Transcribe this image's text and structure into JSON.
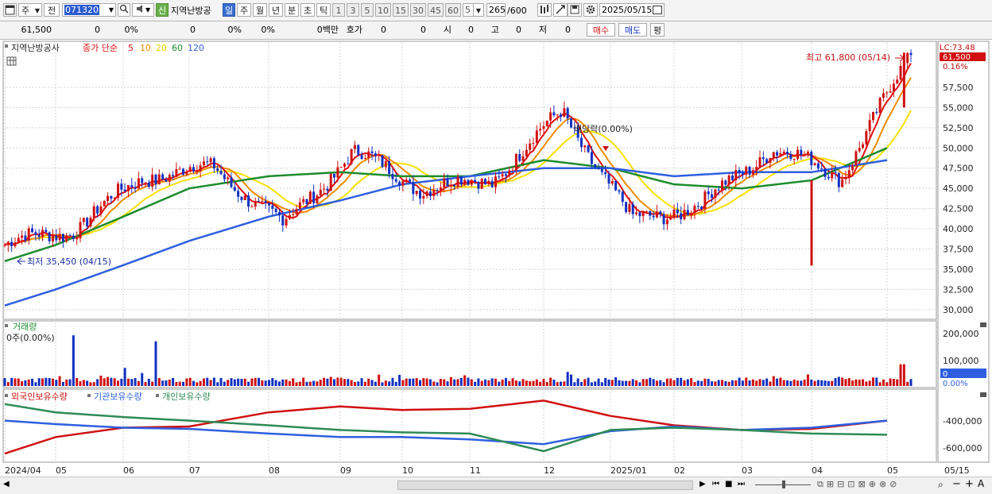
{
  "toolbar": {
    "market_btn": "주",
    "prev_btn": "전",
    "code": "071320",
    "stock_name": "지역난방공",
    "credit_badge": "신",
    "periods": [
      "일",
      "주",
      "월",
      "년",
      "분",
      "초",
      "틱"
    ],
    "selected_period": "일",
    "intervals": [
      "1",
      "3",
      "5",
      "10",
      "15",
      "30",
      "45",
      "60"
    ],
    "interval_value": "5",
    "count": "265",
    "count_max": "/600",
    "date": "2025/05/15"
  },
  "quote": {
    "price": "61,500",
    "change": "0",
    "change_pct": "0%",
    "volume": "0",
    "vol_pct": "0%",
    "vol_pct2": "0%",
    "amount": "0백만",
    "hoga_label": "호가",
    "hoga1": "0",
    "hoga2": "0",
    "open_label": "시",
    "open": "0",
    "high_label": "고",
    "high": "0",
    "low_label": "저",
    "low": "0",
    "buy_btn": "매수",
    "sell_btn": "매도",
    "eval_btn": "평"
  },
  "legend": {
    "stock": "지역난방공사",
    "ma_title": "종가 단순",
    "ma_periods": [
      "5",
      "10",
      "20",
      "60",
      "120"
    ],
    "ma_colors": [
      "#e01010",
      "#f08c00",
      "#f5e100",
      "#1e8c2d",
      "#2f5fe0"
    ]
  },
  "annotations": {
    "high": "최고 61,800 (05/14)",
    "low": "최저 35,450 (04/15)",
    "dividend": "배당락(0.00%)"
  },
  "right_axis": {
    "lc": "LC:73.48",
    "price_tag": "61,500",
    "pct_tag": "0.16%",
    "price_ticks": [
      "57,500",
      "55,000",
      "52,500",
      "50,000",
      "47,500",
      "45,000",
      "42,500",
      "40,000",
      "37,500",
      "35,000",
      "32,500",
      "30,000"
    ],
    "vol_ticks": [
      "200,000",
      "100,000"
    ],
    "vol_tag": "0",
    "vol_pct": "0.00%",
    "hold_ticks": [
      "-400,000",
      "-600,000"
    ]
  },
  "volume_panel": {
    "title": "거래량",
    "value": "0주(0.00%)"
  },
  "holdings_panel": {
    "series": [
      "외국인보유수량",
      "기관보유수량",
      "개인보유수량"
    ]
  },
  "x_axis": {
    "labels": [
      "2024/04",
      "05",
      "06",
      "07",
      "08",
      "09",
      "10",
      "11",
      "12",
      "2025/01",
      "02",
      "03",
      "04",
      "05"
    ],
    "end_label": "05/15"
  },
  "chart_data": {
    "type": "candlestick",
    "title": "지역난방공사",
    "x_range": [
      "2024/04",
      "2025/05/15"
    ],
    "y_range": [
      29000,
      63000
    ],
    "price_points": [
      {
        "month": "2024/04",
        "close": 38000
      },
      {
        "month": "05",
        "close": 40000
      },
      {
        "month": "06",
        "close": 46500
      },
      {
        "month": "07",
        "close": 47500
      },
      {
        "month": "08",
        "close": 40500
      },
      {
        "month": "09",
        "close": 49500
      },
      {
        "month": "10",
        "close": 45000
      },
      {
        "month": "11",
        "close": 46000
      },
      {
        "month": "12",
        "close": 54500
      },
      {
        "month": "2025/01",
        "close": 41000
      },
      {
        "month": "02",
        "close": 43000
      },
      {
        "month": "03",
        "close": 50000
      },
      {
        "month": "04",
        "close": 46500
      },
      {
        "month": "05",
        "close": 61500
      }
    ],
    "high": {
      "value": 61800,
      "date": "05/14"
    },
    "low": {
      "value": 35450,
      "date": "04/15"
    },
    "ma120_points": [
      30500,
      32500,
      35500,
      38500,
      41500,
      43500,
      45500,
      46500,
      47500,
      47500,
      46500,
      47000,
      47000,
      48500
    ],
    "ma60_points": [
      36000,
      38000,
      41500,
      45000,
      46500,
      47000,
      46500,
      46500,
      48500,
      47500,
      45500,
      45000,
      46000,
      50000
    ],
    "volume_ylim": [
      0,
      250000
    ],
    "holdings": {
      "foreigners": [
        -700000,
        -560000,
        -480000,
        -470000,
        -350000,
        -300000,
        -330000,
        -320000,
        -250000,
        -380000,
        -460000,
        -500000,
        -490000,
        -420000
      ],
      "institutions": [
        -420000,
        -450000,
        -480000,
        -490000,
        -530000,
        -560000,
        -560000,
        -580000,
        -620000,
        -510000,
        -470000,
        -500000,
        -480000,
        -420000
      ],
      "individuals": [
        -280000,
        -350000,
        -390000,
        -420000,
        -460000,
        -500000,
        -520000,
        -530000,
        -680000,
        -500000,
        -480000,
        -500000,
        -530000,
        -540000
      ]
    }
  }
}
